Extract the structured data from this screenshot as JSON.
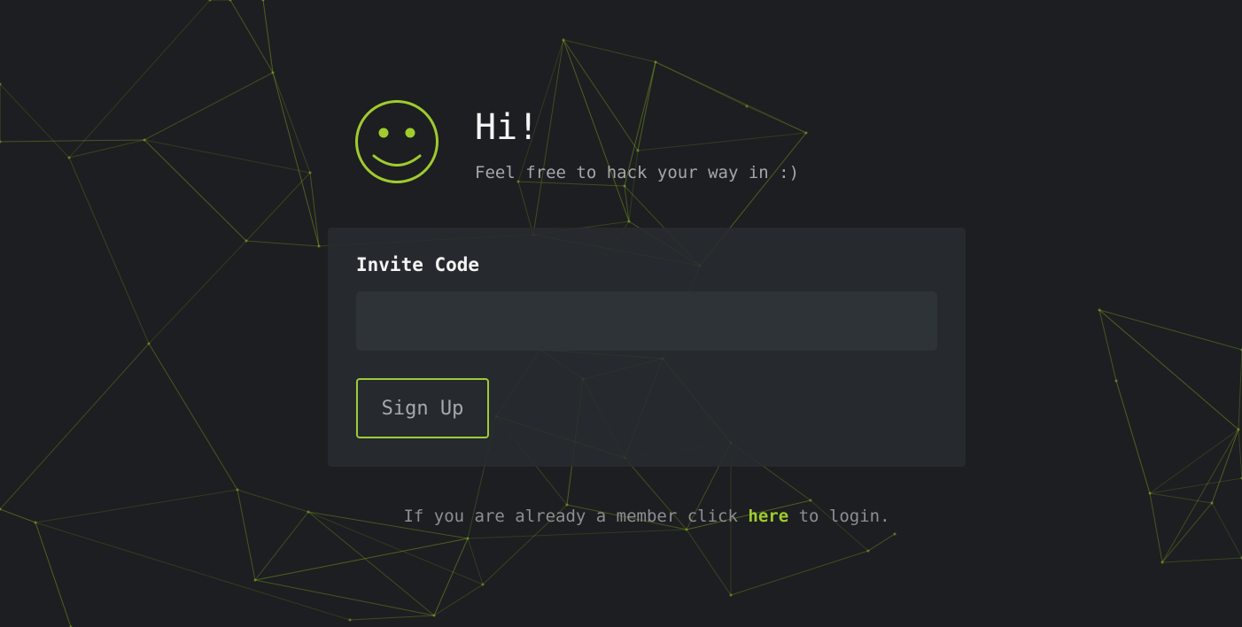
{
  "header": {
    "title": "Hi!",
    "subtitle": "Feel free to hack your way in :)",
    "icon": "smiley-face-icon"
  },
  "form": {
    "invite_label": "Invite Code",
    "invite_value": "",
    "invite_placeholder": "",
    "submit_label": "Sign Up"
  },
  "footer": {
    "prefix": "If you are already a member click ",
    "link_label": "here",
    "suffix": " to login."
  },
  "colors": {
    "accent": "#9fcc2e",
    "background": "#1d1e21",
    "card": "#282b2f",
    "input": "#2e3338",
    "network_lines": "#6b8f1e"
  }
}
